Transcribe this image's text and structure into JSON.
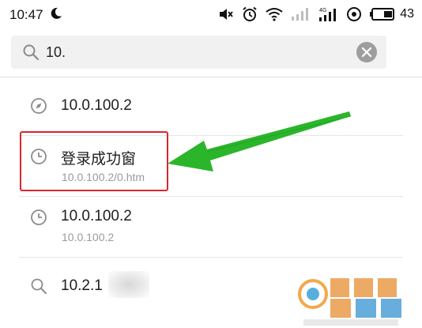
{
  "status_bar": {
    "time": "10:47",
    "battery_percent": "43",
    "network_label": "4G",
    "icons": [
      "moon-icon",
      "mute-icon",
      "alarm-icon",
      "wifi-icon",
      "signal-icon",
      "signal-4g-icon",
      "hotspot-icon",
      "battery-icon"
    ]
  },
  "search": {
    "query": "10.",
    "icon": "search-icon",
    "clear_icon": "clear-icon"
  },
  "results": [
    {
      "icon": "compass-icon",
      "title": "10.0.100.2",
      "subtitle": ""
    },
    {
      "icon": "clock-icon",
      "title": "登录成功窗",
      "subtitle": "10.0.100.2/0.htm",
      "highlighted": true
    },
    {
      "icon": "clock-icon",
      "title": "10.0.100.2",
      "subtitle": "10.0.100.2"
    },
    {
      "icon": "search-icon",
      "title": "10.2.1",
      "subtitle": ""
    }
  ],
  "annotation": {
    "box_color": "#d7262b",
    "arrow_color": "#2bb52b"
  },
  "colors": {
    "searchbar_bg": "#f1f1f1",
    "subtitle": "#9a9a9a"
  }
}
